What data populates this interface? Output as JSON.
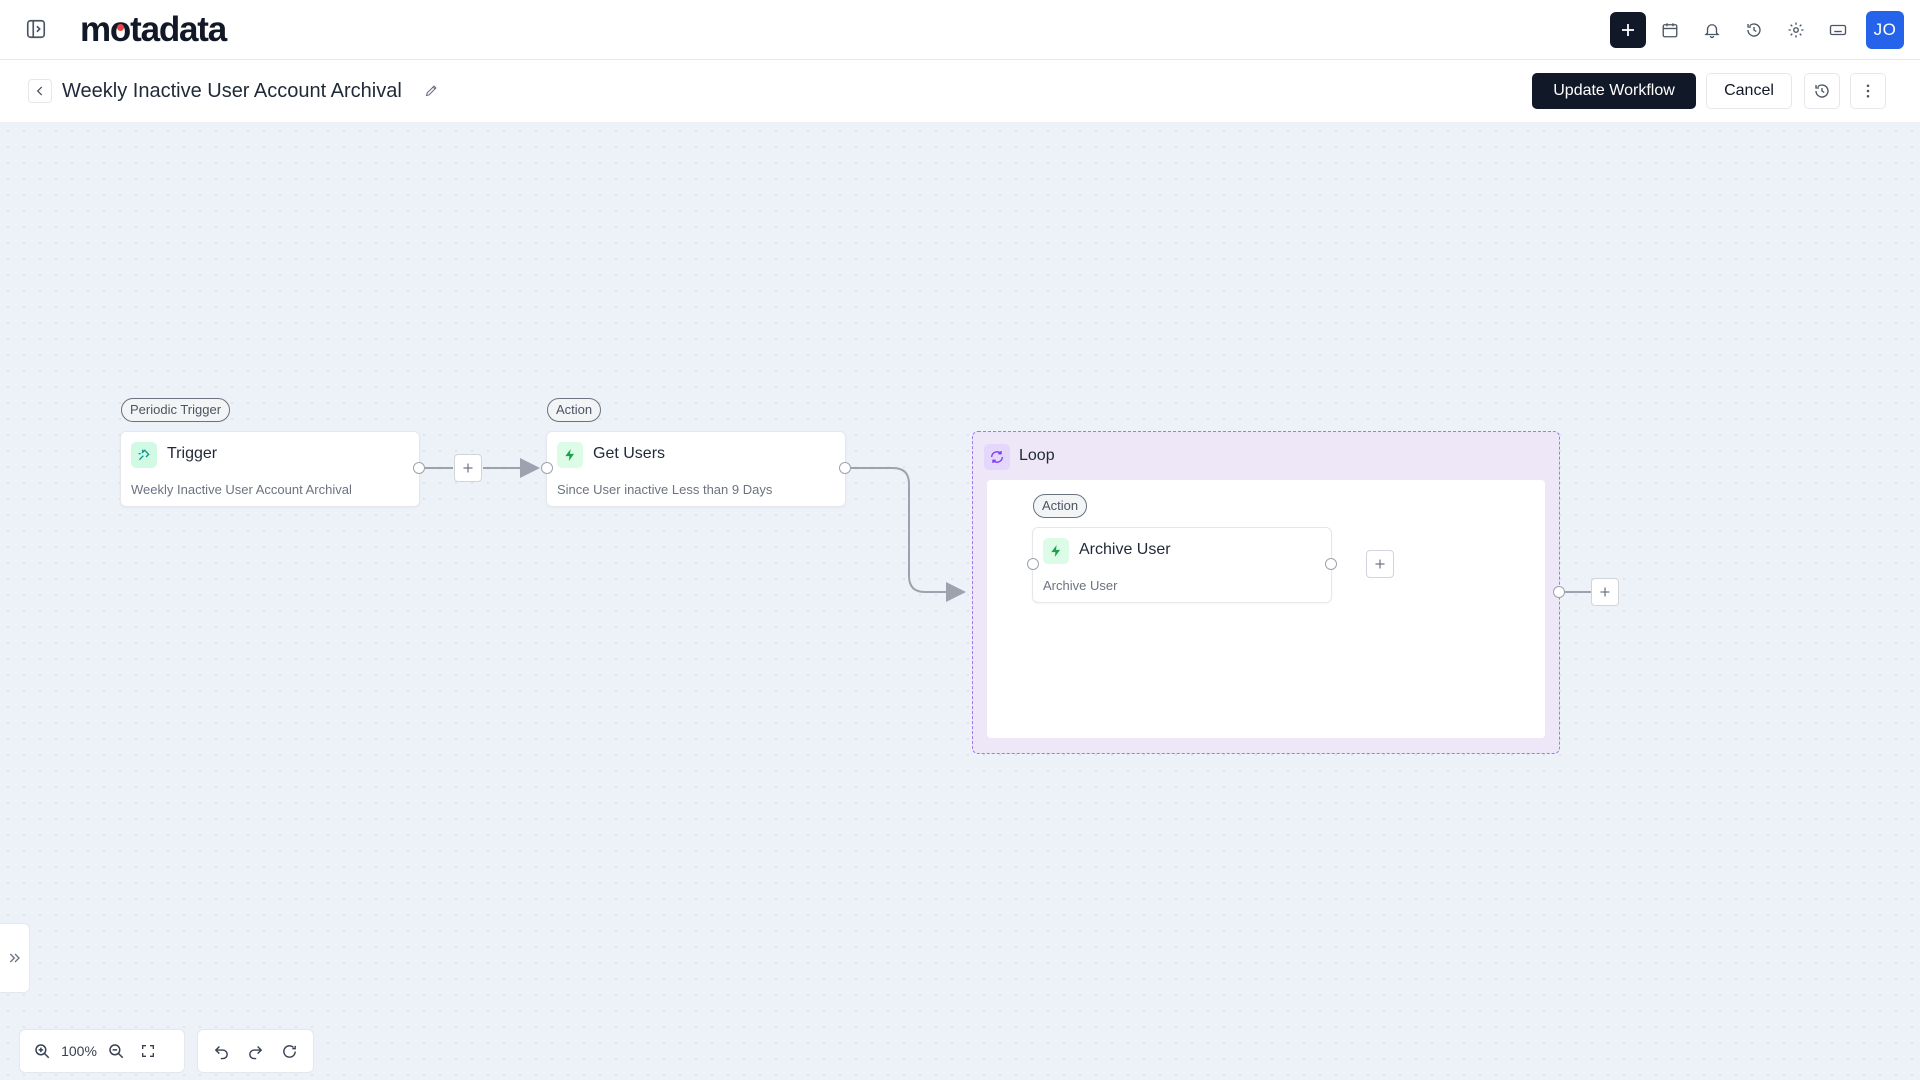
{
  "app": {
    "logo_text": "motadata",
    "avatar_initials": "JO"
  },
  "topbar": {
    "icons": [
      "sidebar-toggle-icon",
      "plus-icon",
      "calendar-icon",
      "bell-icon",
      "history-icon",
      "gear-icon",
      "keyboard-icon"
    ]
  },
  "header": {
    "title": "Weekly Inactive User Account Archival",
    "update_label": "Update Workflow",
    "cancel_label": "Cancel"
  },
  "workflow": {
    "trigger": {
      "tag": "Periodic Trigger",
      "title": "Trigger",
      "description": "Weekly Inactive User Account Archival"
    },
    "get_users": {
      "tag": "Action",
      "title": "Get Users",
      "description": "Since User inactive Less than 9 Days"
    },
    "loop": {
      "title": "Loop",
      "archive_user": {
        "tag": "Action",
        "title": "Archive User",
        "description": "Archive User"
      }
    }
  },
  "controls": {
    "zoom": "100%"
  },
  "colors": {
    "primary": "#111827",
    "avatar": "#2563eb",
    "canvas": "#edf1f8",
    "loop_fill": "#ede7f8",
    "loop_border": "#9f7aea",
    "action_icon": "#16a34a",
    "trigger_icon": "#0d9488",
    "logo_accent": "#ef4444"
  }
}
